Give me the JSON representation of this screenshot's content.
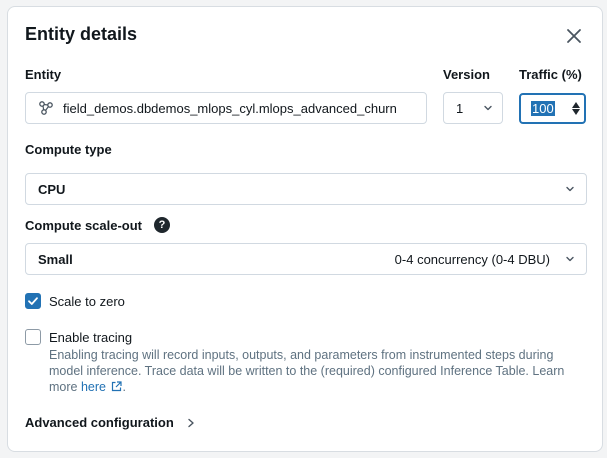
{
  "dialog": {
    "title": "Entity details"
  },
  "entity": {
    "label": "Entity",
    "value": "field_demos.dbdemos_mlops_cyl.mlops_advanced_churn",
    "icon": "model-icon"
  },
  "version": {
    "label": "Version",
    "value": "1"
  },
  "traffic": {
    "label": "Traffic (%)",
    "value": "100"
  },
  "compute_type": {
    "label": "Compute type",
    "value": "CPU"
  },
  "compute_scale_out": {
    "label": "Compute scale-out",
    "help_glyph": "?",
    "value": "Small",
    "detail": "0-4 concurrency (0-4 DBU)"
  },
  "scale_to_zero": {
    "label": "Scale to zero",
    "checked": true
  },
  "tracing": {
    "label": "Enable tracing",
    "checked": false,
    "description_prefix": "Enabling tracing will record inputs, outputs, and parameters from instrumented steps during model inference. Trace data will be written to the (required) configured Inference Table. Learn more ",
    "link_text": "here",
    "description_suffix": "."
  },
  "advanced": {
    "label": "Advanced configuration"
  },
  "colors": {
    "accent": "#2272b4",
    "text": "#11171c",
    "muted": "#5f7281",
    "border": "#d1d9e1"
  }
}
